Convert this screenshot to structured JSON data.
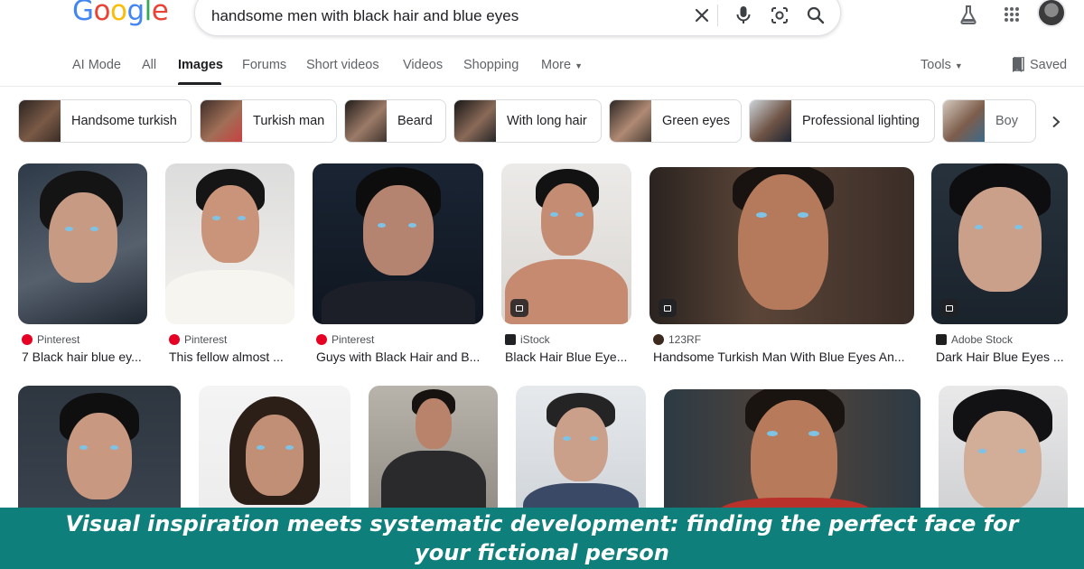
{
  "header": {
    "logo": "Google",
    "search_value": "handsome men with black hair and blue eyes"
  },
  "icons": {
    "clear": "close-icon",
    "voice": "microphone-icon",
    "lens": "lens-camera-icon",
    "search": "search-icon",
    "labs": "flask-icon",
    "apps": "apps-grid-icon",
    "saved": "bookmark-icon"
  },
  "tabs": [
    {
      "label": "AI Mode"
    },
    {
      "label": "All"
    },
    {
      "label": "Images"
    },
    {
      "label": "Forums"
    },
    {
      "label": "Short videos"
    },
    {
      "label": "Videos"
    },
    {
      "label": "Shopping"
    },
    {
      "label": "More"
    }
  ],
  "tools_label": "Tools",
  "saved_label": "Saved",
  "chips": [
    {
      "label": "Handsome turkish"
    },
    {
      "label": "Turkish man"
    },
    {
      "label": "Beard"
    },
    {
      "label": "With long hair"
    },
    {
      "label": "Green eyes"
    },
    {
      "label": "Professional lighting"
    },
    {
      "label": "Boy"
    }
  ],
  "results_row1": [
    {
      "source": "Pinterest",
      "title": "7 Black hair blue ey..."
    },
    {
      "source": "Pinterest",
      "title": "This fellow almost ..."
    },
    {
      "source": "Pinterest",
      "title": "Guys with Black Hair and B..."
    },
    {
      "source": "iStock",
      "title": "Black Hair Blue Eye..."
    },
    {
      "source": "123RF",
      "title": "Handsome Turkish Man With Blue Eyes An..."
    },
    {
      "source": "Adobe Stock",
      "title": "Dark Hair Blue Eyes ..."
    }
  ],
  "caption": "Visual inspiration meets systematic development: finding the perfect face for your fictional person",
  "colors": {
    "banner": "#0e7f7a",
    "pinterest": "#e60023",
    "istock": "#202124",
    "rf": "#3c2a1e",
    "adobe": "#1f1f1f"
  }
}
